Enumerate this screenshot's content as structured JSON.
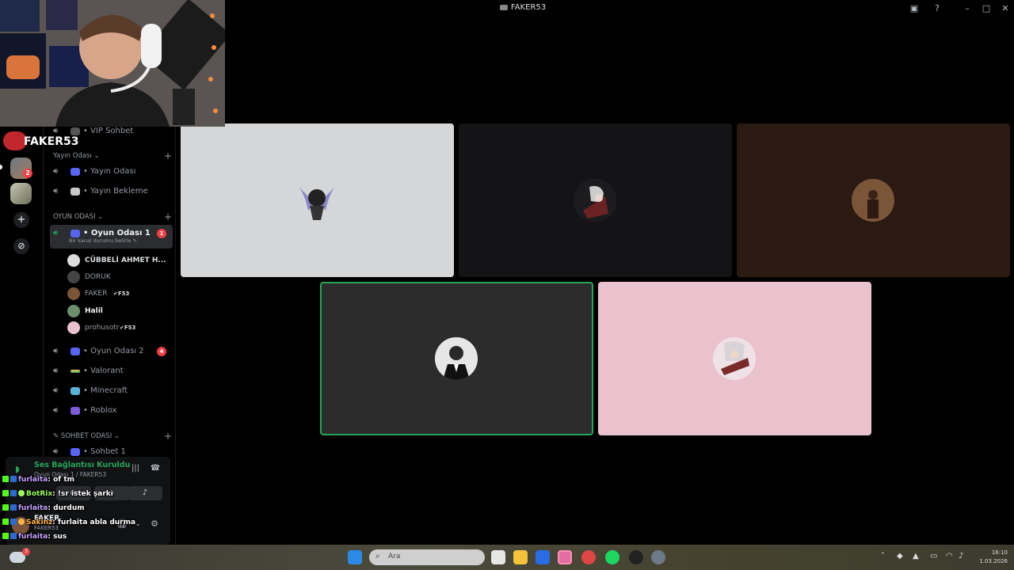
{
  "window": {
    "title": "FAKER53"
  },
  "server": {
    "name": "FAKER53"
  },
  "channels": {
    "vip": "VIP Sohbet",
    "cat_yayin": "Yayın Odası",
    "yayin_odasi": "Yayın Odası",
    "yayin_bekleme": "Yayın Bekleme",
    "cat_oyun": "OYUN ODASI",
    "oyun1": "Oyun Odası 1",
    "oyun1_badge": "1",
    "oyun1_status": "Bir kanal durumu belirle",
    "oyun2": "Oyun Odası 2",
    "oyun2_badge": "4",
    "valorant": "Valorant",
    "minecraft": "Minecraft",
    "roblox": "Roblox",
    "cat_sohbet": "SOHBET ODASI",
    "sohbet1": "Sohbet 1"
  },
  "members": [
    {
      "name": "CÜBBELİ AHMET H...",
      "tag": ""
    },
    {
      "name": "DORUK",
      "tag": ""
    },
    {
      "name": "FAKER",
      "tag": "F53"
    },
    {
      "name": "Halil",
      "tag": ""
    },
    {
      "name": "prohusotr",
      "tag": "F53"
    }
  ],
  "server_badges": {
    "first": "2"
  },
  "voice": {
    "status": "Ses Bağlantısı Kuruldu",
    "location": "Oyun Odası 1 / FAKER53"
  },
  "user": {
    "name": "FAKER",
    "sub": "FAKER53"
  },
  "chat": [
    {
      "user": "furlaita",
      "msg": ": of tm",
      "color": "#c8a2ff"
    },
    {
      "user": "BotRix",
      "msg": ": !sr istek şarkı",
      "color": "#9cff57"
    },
    {
      "user": "furlaita",
      "msg": ": durdum",
      "color": "#c8a2ff"
    },
    {
      "user": "Sakinz",
      "msg": ": furlaita abla durma",
      "color": "#ffb347"
    },
    {
      "user": "furlaita",
      "msg": ": sus",
      "color": "#c8a2ff"
    }
  ],
  "taskbar": {
    "search_placeholder": "Ara",
    "time": "16:10",
    "date": "1.03.2026",
    "notify_count": "3"
  },
  "colors": {
    "speaking": "#23a55a",
    "badge": "#f23f43",
    "tile1": "#d5d6d8",
    "tile2": "#141417",
    "tile3": "#2b1a12",
    "tile4": "#2c2c2c",
    "tile5": "#e9c2cd"
  }
}
